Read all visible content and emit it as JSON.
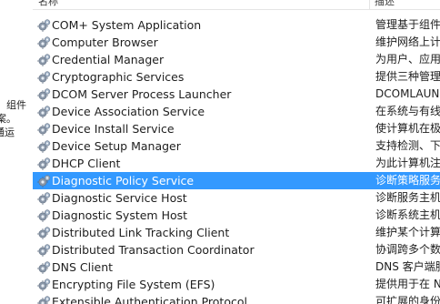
{
  "left_pane": {
    "line1": "组件",
    "line2": "方案。",
    "line3": "通运"
  },
  "columns": {
    "name": "名称",
    "description": "描述"
  },
  "selected_index": 9,
  "services": [
    {
      "name": "COM+ System Application",
      "description": "管理基于组件"
    },
    {
      "name": "Computer Browser",
      "description": "维护网络上计"
    },
    {
      "name": "Credential Manager",
      "description": "为用户、应用"
    },
    {
      "name": "Cryptographic Services",
      "description": "提供三种管理"
    },
    {
      "name": "DCOM Server Process Launcher",
      "description": "DCOMLAUN"
    },
    {
      "name": "Device Association Service",
      "description": "在系统与有线"
    },
    {
      "name": "Device Install Service",
      "description": "使计算机在极"
    },
    {
      "name": "Device Setup Manager",
      "description": "支持检测、下"
    },
    {
      "name": "DHCP Client",
      "description": "为此计算机注"
    },
    {
      "name": "Diagnostic Policy Service",
      "description": "诊断策略服务"
    },
    {
      "name": "Diagnostic Service Host",
      "description": "诊断服务主机"
    },
    {
      "name": "Diagnostic System Host",
      "description": "诊断系统主机"
    },
    {
      "name": "Distributed Link Tracking Client",
      "description": "维护某个计算"
    },
    {
      "name": "Distributed Transaction Coordinator",
      "description": "协调跨多个数"
    },
    {
      "name": "DNS Client",
      "description": "DNS 客户端服"
    },
    {
      "name": "Encrypting File System (EFS)",
      "description": "提供用于在 N"
    },
    {
      "name": "Extensible Authentication Protocol",
      "description": "可扩展的身份"
    }
  ],
  "icon": "gear-service-icon"
}
